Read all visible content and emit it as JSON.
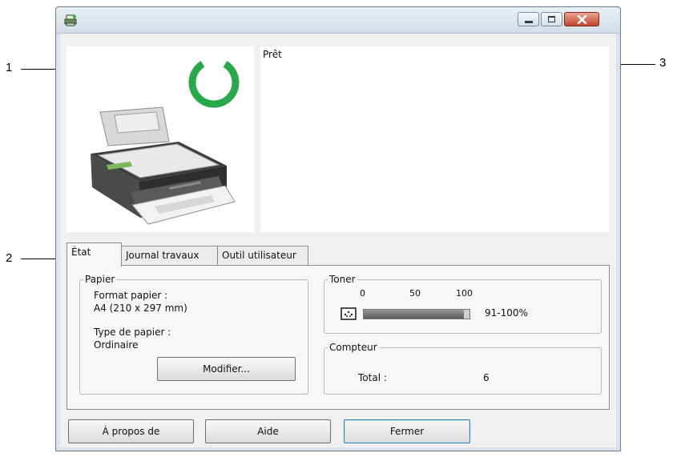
{
  "callouts": [
    "1",
    "2",
    "3"
  ],
  "status": {
    "message": "Prêt"
  },
  "tabs": [
    {
      "label": "État",
      "active": true
    },
    {
      "label": "Journal travaux",
      "active": false
    },
    {
      "label": "Outil utilisateur",
      "active": false
    }
  ],
  "paper": {
    "legend": "Papier",
    "format_label": "Format papier :",
    "format_value": "A4 (210 x 297 mm)",
    "type_label": "Type de papier :",
    "type_value": "Ordinaire",
    "modify_button": "Modifier..."
  },
  "toner": {
    "legend": "Toner",
    "scale": [
      "0",
      "50",
      "100"
    ],
    "level_percent": 95,
    "level_text": "91-100%"
  },
  "counter": {
    "legend": "Compteur",
    "total_label": "Total :",
    "total_value": "6"
  },
  "buttons": {
    "about": "À propos de",
    "help": "Aide",
    "close": "Fermer"
  },
  "colors": {
    "ready_ring": "#27a84a",
    "close_button": "#c4452b"
  }
}
